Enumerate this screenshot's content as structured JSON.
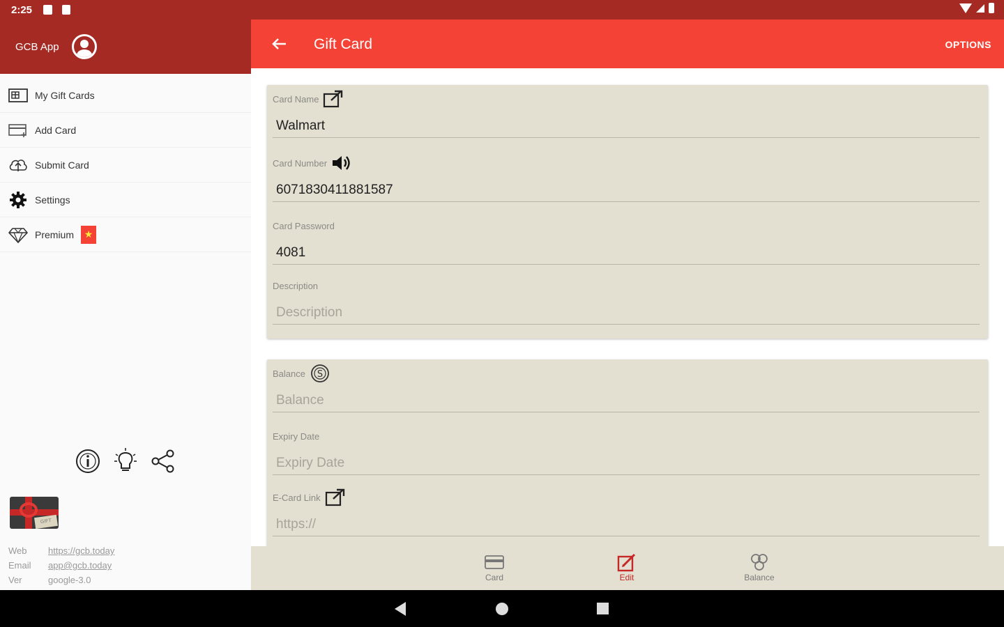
{
  "status_bar": {
    "time": "2:25"
  },
  "drawer": {
    "app_name": "GCB App",
    "menu": [
      {
        "label": "My Gift Cards",
        "icon": "gift-card-icon"
      },
      {
        "label": "Add Card",
        "icon": "add-card-icon"
      },
      {
        "label": "Submit Card",
        "icon": "cloud-upload-icon"
      },
      {
        "label": "Settings",
        "icon": "gear-icon"
      },
      {
        "label": "Premium",
        "icon": "diamond-icon"
      }
    ],
    "premium_badge": "★",
    "gift_tag_text": "GIFT",
    "info": {
      "web_label": "Web",
      "web_value": "https://gcb.today",
      "email_label": "Email",
      "email_value": "app@gcb.today",
      "ver_label": "Ver",
      "ver_value": "google-3.0"
    }
  },
  "appbar": {
    "title": "Gift Card",
    "options": "OPTIONS"
  },
  "form": {
    "card_name": {
      "label": "Card Name",
      "value": "Walmart"
    },
    "card_number": {
      "label": "Card Number",
      "value": "6071830411881587"
    },
    "card_password": {
      "label": "Card Password",
      "value": "4081"
    },
    "description": {
      "label": "Description",
      "placeholder": "Description"
    },
    "balance": {
      "label": "Balance",
      "placeholder": "Balance"
    },
    "expiry": {
      "label": "Expiry Date",
      "placeholder": "Expiry Date"
    },
    "ecard_link": {
      "label": "E-Card Link",
      "placeholder": "https://"
    }
  },
  "bottom_nav": {
    "card": "Card",
    "edit": "Edit",
    "balance": "Balance"
  },
  "colors": {
    "primary": "#f44336",
    "primary_dark": "#a52a24",
    "card_bg": "#e3dfd1",
    "accent": "#c62828"
  }
}
